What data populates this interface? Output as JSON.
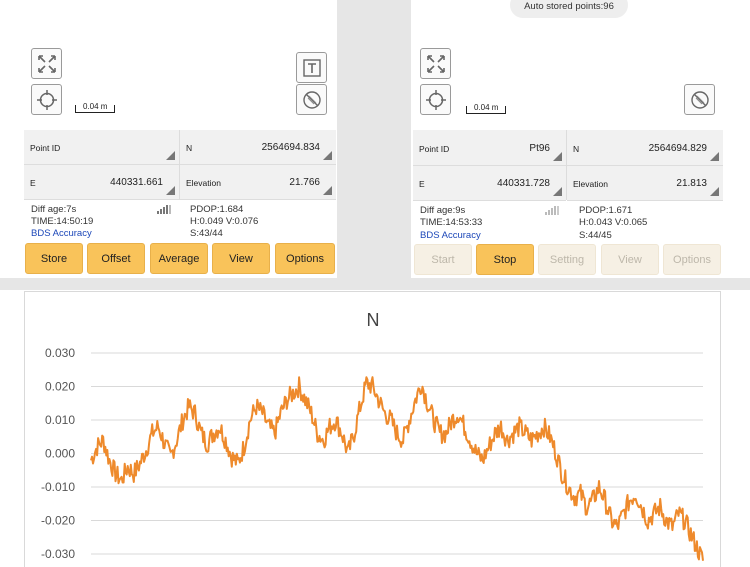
{
  "left_panel": {
    "scale_label": "0.04 m",
    "fields": {
      "point_id": {
        "label": "Point ID",
        "value": ""
      },
      "n": {
        "label": "N",
        "value": "2564694.834"
      },
      "e": {
        "label": "E",
        "value": "440331.661"
      },
      "elevation": {
        "label": "Elevation",
        "value": "21.766"
      }
    },
    "status": {
      "diff_age": "Diff age:7s",
      "time": "TIME:14:50:19",
      "bds": "BDS Accuracy",
      "pdop": "PDOP:1.684",
      "hv": "H:0.049  V:0.076",
      "sats": "S:43/44"
    },
    "buttons": [
      "Store",
      "Offset",
      "Average",
      "View",
      "Options"
    ]
  },
  "right_panel": {
    "toast": "Auto stored points:96",
    "scale_label": "0.04 m",
    "fields": {
      "point_id": {
        "label": "Point ID",
        "value": "Pt96"
      },
      "n": {
        "label": "N",
        "value": "2564694.829"
      },
      "e": {
        "label": "E",
        "value": "440331.728"
      },
      "elevation": {
        "label": "Elevation",
        "value": "21.813"
      }
    },
    "status": {
      "diff_age": "Diff age:9s",
      "time": "TIME:14:53:33",
      "bds": "BDS Accuracy",
      "pdop": "PDOP:1.671",
      "hv": "H:0.043  V:0.065",
      "sats": "S:44/45"
    },
    "buttons": [
      "Start",
      "Stop",
      "Setting",
      "View",
      "Options"
    ],
    "buttons_enabled": [
      false,
      true,
      false,
      false,
      false
    ]
  },
  "colors": {
    "button": "#f9c35a",
    "button_disabled": "#f6f0e4",
    "series": "#ee8a2c",
    "bds_text": "#1c47b8"
  },
  "icons": [
    "expand-icon",
    "locate-icon",
    "text-icon",
    "no-signal-icon",
    "signal-bars-icon"
  ],
  "chart_data": {
    "type": "line",
    "title": "N",
    "xlabel": "",
    "ylabel": "",
    "ylim": [
      -0.03,
      0.03
    ],
    "yticks": [
      "0.030",
      "0.020",
      "0.010",
      "0.000",
      "-0.010",
      "-0.020",
      "-0.030"
    ],
    "grid": true,
    "legend": "none",
    "series": [
      {
        "color": "#ee8a2c",
        "values": [
          -0.002,
          0.002,
          0.004,
          -0.002,
          -0.006,
          -0.008,
          -0.004,
          -0.006,
          -0.003,
          0.001,
          0.006,
          0.008,
          0.003,
          -0.001,
          0.004,
          0.01,
          0.014,
          0.012,
          0.006,
          0.003,
          0.006,
          0.008,
          0.004,
          -0.001,
          -0.003,
          0.002,
          0.01,
          0.014,
          0.012,
          0.008,
          0.006,
          0.012,
          0.016,
          0.018,
          0.02,
          0.016,
          0.012,
          0.006,
          0.004,
          0.008,
          0.01,
          0.006,
          0.0,
          0.006,
          0.014,
          0.021,
          0.02,
          0.016,
          0.012,
          0.01,
          0.006,
          0.004,
          0.01,
          0.016,
          0.021,
          0.015,
          0.01,
          0.006,
          0.006,
          0.01,
          0.012,
          0.008,
          0.004,
          0.0,
          -0.002,
          0.002,
          0.006,
          0.008,
          0.004,
          0.006,
          0.008,
          0.006,
          0.004,
          0.006,
          0.008,
          0.005,
          0.0,
          -0.006,
          -0.01,
          -0.013,
          -0.012,
          -0.016,
          -0.014,
          -0.01,
          -0.014,
          -0.02,
          -0.022,
          -0.018,
          -0.014,
          -0.012,
          -0.016,
          -0.02,
          -0.018,
          -0.016,
          -0.02,
          -0.022,
          -0.018,
          -0.02,
          -0.024,
          -0.028,
          -0.032
        ]
      }
    ]
  }
}
